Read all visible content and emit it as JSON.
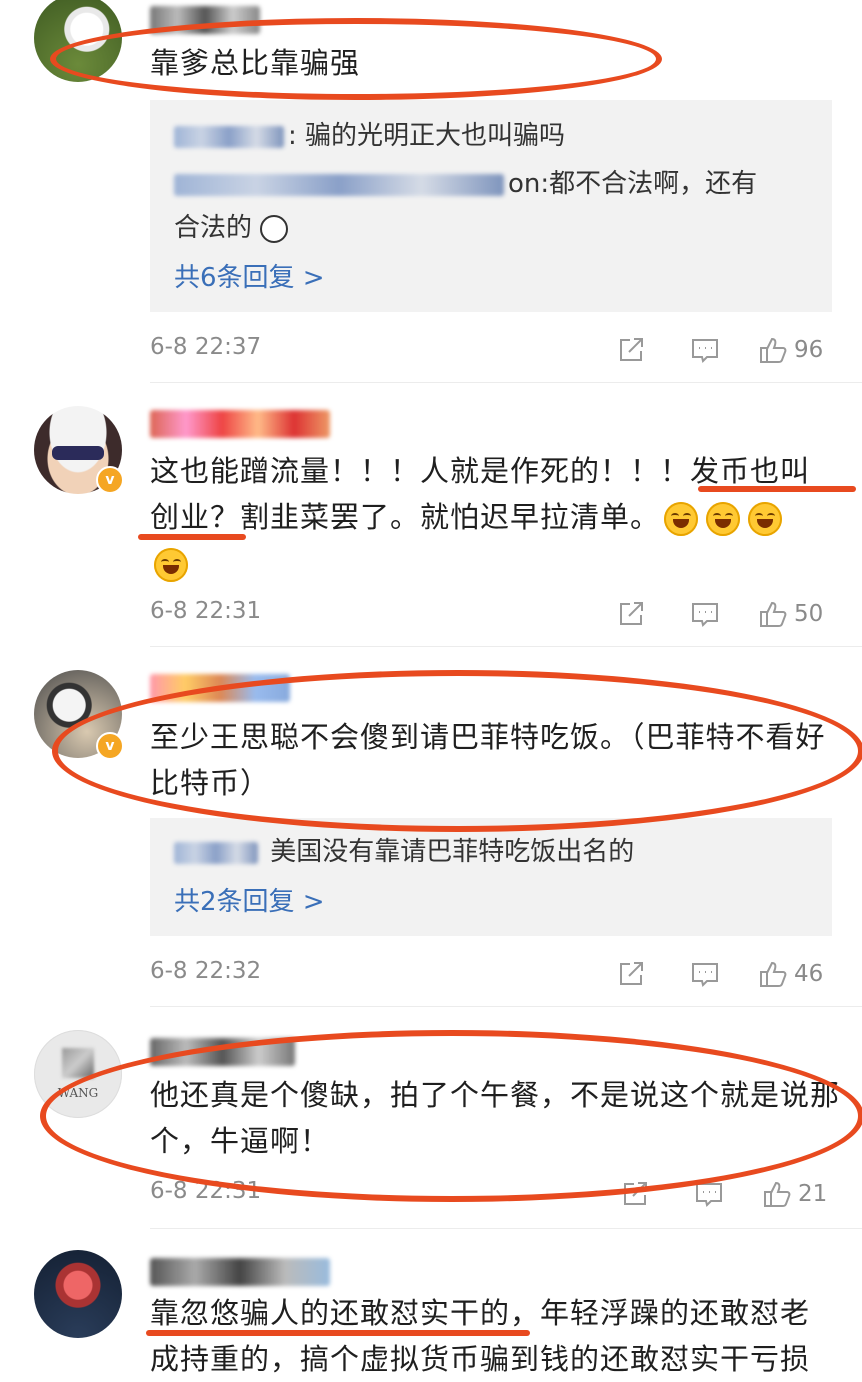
{
  "colors": {
    "annotation": "#e84a1f",
    "link": "#3a6fb8",
    "meta": "#8a8a8a",
    "reply_bg": "#f2f2f2"
  },
  "comments": [
    {
      "text": "靠爹总比靠骗强",
      "replies": [
        {
          "text": ": 骗的光明正大也叫骗吗"
        },
        {
          "text": "on:都不合法啊，还有"
        },
        {
          "text": "合法的"
        }
      ],
      "more": "共6条回复 >",
      "time": "6-8 22:37",
      "likes": "96"
    },
    {
      "text_a": "这也能蹭流量！！！人就是作死的！！！",
      "text_b": "发币也叫",
      "text_c": "创业？",
      "text_d": "割韭菜罢了。就怕迟早拉清单。",
      "time": "6-8 22:31",
      "likes": "50"
    },
    {
      "text": "至少王思聪不会傻到请巴菲特吃饭。（巴菲特不看好比特币）",
      "replies": [
        {
          "text": "美国没有靠请巴菲特吃饭出名的"
        }
      ],
      "more": "共2条回复 >",
      "time": "6-8 22:32",
      "likes": "46"
    },
    {
      "avatar_label": "WANG",
      "text": "他还真是个傻缺，拍了个午餐，不是说这个就是说那个，牛逼啊！",
      "time": "6-8 22:31",
      "likes": "21"
    },
    {
      "text_a": "靠忽悠骗人的还敢怼实干的",
      "text_b": "，年轻浮躁的还敢怼老成持重的，搞个虚拟货币骗到钱的还敢怼实干亏损"
    }
  ],
  "icons": {
    "share": "share-icon",
    "comment": "comment-icon",
    "like": "thumbs-up-icon",
    "verified": "verified-badge-icon",
    "emoji": "laughing-tears-emoji-icon"
  }
}
